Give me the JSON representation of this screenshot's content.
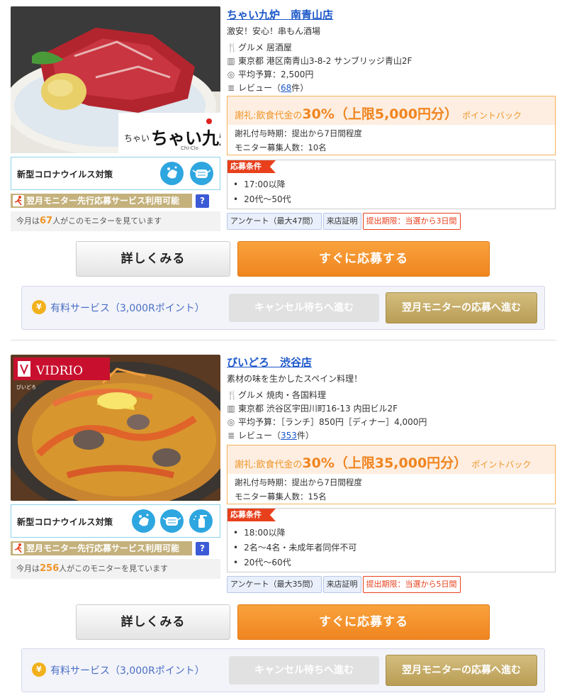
{
  "listings": [
    {
      "shop_name": "ちゃい九炉　南青山店",
      "catch": "激安！安心！串もん酒場",
      "genre": "グルメ 居酒屋",
      "address": "東京都 港区南青山3-8-2 サンブリッジ青山2F",
      "budget": "平均予算：2,500円",
      "review_prefix": "レビュー（",
      "review_count": "68",
      "review_suffix": "件）",
      "logo_text": "ちゃい九炉",
      "logo_sub": "Chi-Clo",
      "corona_label": "新型コロナウイルス対策",
      "next_month_label": "翌月モニター先行応募サービス利用可能",
      "help_label": "?",
      "viewers_prefix": "今月は",
      "viewers_count": "67",
      "viewers_suffix": "人がこのモニターを見ています",
      "reward_prefix": "謝礼:飲食代金の",
      "reward_rate": "30%（上限5,000円分）",
      "reward_suffix": "ポイントバック",
      "reward_timing": "謝礼付与時期：提出から7日間程度",
      "monitor_count": "モニター募集人数：10名",
      "conditions_tag": "応募条件",
      "conditions": [
        "17:00以降",
        "20代〜50代"
      ],
      "badge_survey": "アンケート（最大47問）",
      "badge_proof": "来店証明",
      "badge_deadline": "提出期限：当選から3日間",
      "detail_button": "詳しくみる",
      "apply_button": "すぐに応募する",
      "paid_yen": "¥",
      "paid_label": "有料サービス（3,000Rポイント）",
      "cancel_wait_button": "キャンセル待ちへ進む",
      "next_month_button": "翌月モニターの応募へ進む"
    },
    {
      "shop_name": "びいどろ　渋谷店",
      "catch": "素材の味を生かしたスペイン料理！",
      "genre": "グルメ 焼肉・各国料理",
      "address": "東京都 渋谷区宇田川町16-13 内田ビル2F",
      "budget": "平均予算：［ランチ］850円［ディナー］4,000円",
      "review_prefix": "レビュー（",
      "review_count": "353",
      "review_suffix": "件）",
      "logo_text": "VIDRIO",
      "logo_sub": "びいどろ",
      "corona_label": "新型コロナウイルス対策",
      "next_month_label": "翌月モニター先行応募サービス利用可能",
      "help_label": "?",
      "viewers_prefix": "今月は",
      "viewers_count": "256",
      "viewers_suffix": "人がこのモニターを見ています",
      "reward_prefix": "謝礼:飲食代金の",
      "reward_rate": "30%（上限35,000円分）",
      "reward_suffix": "ポイントバック",
      "reward_timing": "謝礼付与時期：提出から7日間程度",
      "monitor_count": "モニター募集人数：15名",
      "conditions_tag": "応募条件",
      "conditions": [
        "18:00以降",
        "2名〜4名・未成年者同伴不可",
        "20代〜60代"
      ],
      "badge_survey": "アンケート（最大35問）",
      "badge_proof": "来店証明",
      "badge_deadline": "提出期限：当選から5日間",
      "detail_button": "詳しくみる",
      "apply_button": "すぐに応募する",
      "paid_yen": "¥",
      "paid_label": "有料サービス（3,000Rポイント）",
      "cancel_wait_button": "キャンセル待ちへ進む",
      "next_month_button": "翌月モニターの応募へ進む"
    }
  ],
  "colors": {
    "accent_orange": "#f08520",
    "link_blue": "#1a56c8",
    "gold": "#c4b17c",
    "condition_red": "#e8401c"
  }
}
